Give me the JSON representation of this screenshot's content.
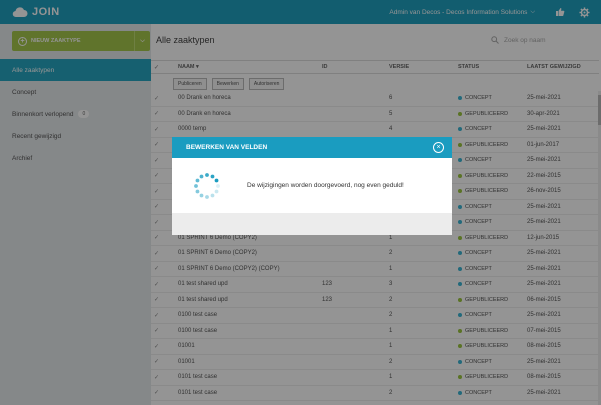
{
  "header": {
    "app_name": "JOIN",
    "user": "Admin van Decos - Decos Information Solutions"
  },
  "sidebar": {
    "new_button_label": "NIEUW ZAAKTYPE",
    "items": [
      {
        "label": "Alle zaaktypen",
        "active": true
      },
      {
        "label": "Concept"
      },
      {
        "label": "Binnenkort verlopend",
        "badge": "0"
      },
      {
        "label": "Recent gewijzigd"
      },
      {
        "label": "Archief"
      }
    ]
  },
  "main": {
    "title": "Alle zaaktypen",
    "search_placeholder": "Zoek op naam",
    "columns": {
      "naam": "NAAM",
      "id": "ID",
      "versie": "VERSIE",
      "status": "STATUS",
      "date": "LAATST GEWIJZIGD"
    },
    "toolbar": [
      "Publiceren",
      "Bewerken",
      "Autoriseren"
    ],
    "rows": [
      {
        "naam": "00 Drank en horeca",
        "id": "",
        "versie": "6",
        "status": "CONCEPT",
        "date": "25-mei-2021"
      },
      {
        "naam": "00 Drank en horeca",
        "id": "",
        "versie": "5",
        "status": "GEPUBLICEERD",
        "date": "30-apr-2021"
      },
      {
        "naam": "0000 temp",
        "id": "",
        "versie": "4",
        "status": "CONCEPT",
        "date": "25-mei-2021"
      },
      {
        "naam": "",
        "id": "",
        "versie": "",
        "status": "GEPUBLICEERD",
        "date": "01-jun-2017"
      },
      {
        "naam": "",
        "id": "",
        "versie": "",
        "status": "CONCEPT",
        "date": "25-mei-2021"
      },
      {
        "naam": "",
        "id": "",
        "versie": "",
        "status": "GEPUBLICEERD",
        "date": "22-mei-2015"
      },
      {
        "naam": "",
        "id": "",
        "versie": "",
        "status": "GEPUBLICEERD",
        "date": "26-nov-2015"
      },
      {
        "naam": "",
        "id": "",
        "versie": "",
        "status": "CONCEPT",
        "date": "25-mei-2021"
      },
      {
        "naam": "",
        "id": "",
        "versie": "",
        "status": "CONCEPT",
        "date": "25-mei-2021"
      },
      {
        "naam": "01 SPRINT 6 Demo (COPY2)",
        "id": "",
        "versie": "1",
        "status": "GEPUBLICEERD",
        "date": "12-jun-2015"
      },
      {
        "naam": "01 SPRINT 6 Demo (COPY2)",
        "id": "",
        "versie": "2",
        "status": "CONCEPT",
        "date": "25-mei-2021"
      },
      {
        "naam": "01 SPRINT 6 Demo (COPY2) (COPY)",
        "id": "",
        "versie": "1",
        "status": "CONCEPT",
        "date": "25-mei-2021"
      },
      {
        "naam": "01 test shared upd",
        "id": "123",
        "versie": "3",
        "status": "CONCEPT",
        "date": "25-mei-2021"
      },
      {
        "naam": "01 test shared upd",
        "id": "123",
        "versie": "2",
        "status": "GEPUBLICEERD",
        "date": "06-mei-2015"
      },
      {
        "naam": "0100 test case",
        "id": "",
        "versie": "2",
        "status": "CONCEPT",
        "date": "25-mei-2021"
      },
      {
        "naam": "0100 test case",
        "id": "",
        "versie": "1",
        "status": "GEPUBLICEERD",
        "date": "07-mei-2015"
      },
      {
        "naam": "01001",
        "id": "",
        "versie": "1",
        "status": "GEPUBLICEERD",
        "date": "08-mei-2015"
      },
      {
        "naam": "01001",
        "id": "",
        "versie": "2",
        "status": "CONCEPT",
        "date": "25-mei-2021"
      },
      {
        "naam": "0101 test case",
        "id": "",
        "versie": "1",
        "status": "GEPUBLICEERD",
        "date": "08-mei-2015"
      },
      {
        "naam": "0101 test case",
        "id": "",
        "versie": "2",
        "status": "CONCEPT",
        "date": "25-mei-2021"
      }
    ]
  },
  "status_colors": {
    "CONCEPT": "#3cb6d4",
    "GEPUBLICEERD": "#9cc63e"
  },
  "modal": {
    "title": "BEWERKEN VAN VELDEN",
    "message": "De wijzigingen worden doorgevoerd, nog even geduld!"
  }
}
